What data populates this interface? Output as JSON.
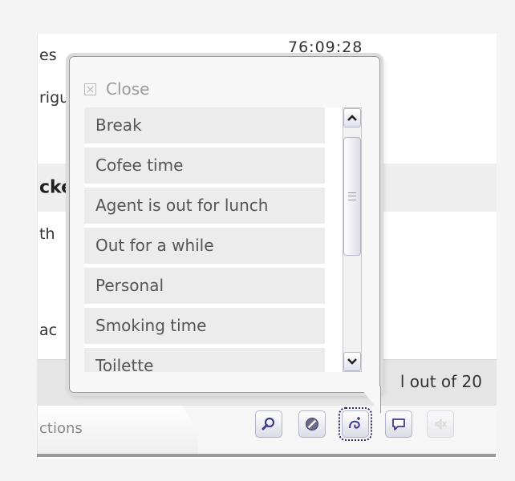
{
  "background_rows": [
    {
      "text": "es",
      "value": "76:09:28"
    },
    {
      "text": "rigu",
      "value": ""
    },
    {
      "text": "",
      "value": ""
    },
    {
      "text": "cke",
      "value": ""
    },
    {
      "text": "th",
      "value": ""
    },
    {
      "text": "",
      "value": ""
    },
    {
      "text": "ac",
      "value": ""
    }
  ],
  "summary": {
    "text": "l out of 20"
  },
  "actions": {
    "label": "ctions"
  },
  "toolbar": {
    "buttons": [
      {
        "icon": "magnifier-icon"
      },
      {
        "icon": "no-entry-icon"
      },
      {
        "icon": "break-status-icon",
        "selected": true
      },
      {
        "icon": "speech-bubble-icon"
      },
      {
        "icon": "mute-icon",
        "disabled": true
      }
    ]
  },
  "popup": {
    "close_label": "Close",
    "items": [
      "Break",
      "Cofee time",
      "Agent is out for lunch",
      "Out for a while",
      "Personal",
      "Smoking time",
      "Toilette"
    ]
  },
  "colors": {
    "accent": "#3a3a8a",
    "popup_bg": "#f7f7f7",
    "item_bg": "#ececec"
  }
}
